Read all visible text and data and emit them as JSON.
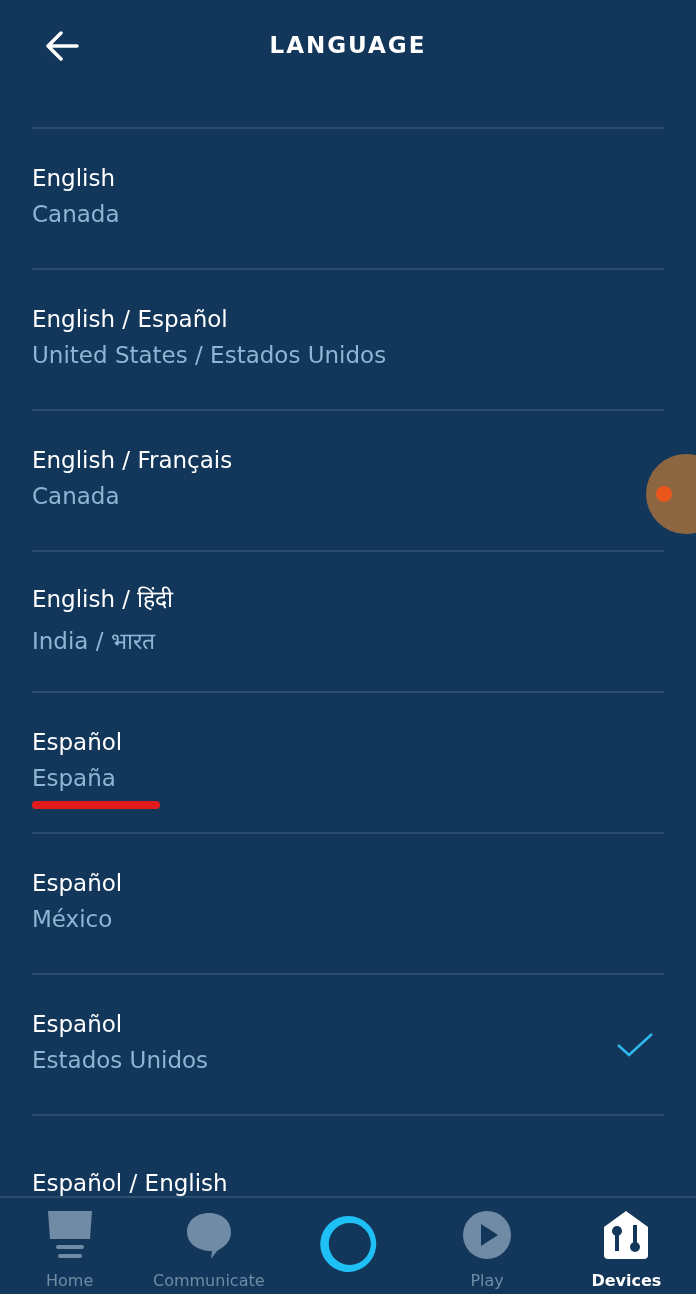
{
  "header": {
    "title": "LANGUAGE"
  },
  "languages": [
    {
      "language": "English",
      "region": "Canada",
      "selected": false,
      "underlined": false
    },
    {
      "language": "English / Español",
      "region": "United States / Estados Unidos",
      "selected": false,
      "underlined": false
    },
    {
      "language": "English / Français",
      "region": "Canada",
      "selected": false,
      "underlined": false
    },
    {
      "language": "English / हिंदी",
      "region": "India / भारत",
      "selected": false,
      "underlined": false
    },
    {
      "language": "Español",
      "region": "España",
      "selected": false,
      "underlined": true
    },
    {
      "language": "Español",
      "region": "México",
      "selected": false,
      "underlined": false
    },
    {
      "language": "Español",
      "region": "Estados Unidos",
      "selected": true,
      "underlined": false
    },
    {
      "language": "Español / English",
      "selected": false
    }
  ],
  "nav": [
    {
      "kind": "home",
      "label": "Home",
      "selected": false
    },
    {
      "kind": "communicate",
      "label": "Communicate",
      "selected": false
    },
    {
      "kind": "alexa"
    },
    {
      "kind": "play",
      "label": "Play",
      "selected": false
    },
    {
      "kind": "devices",
      "label": "Devices",
      "selected": true
    }
  ]
}
